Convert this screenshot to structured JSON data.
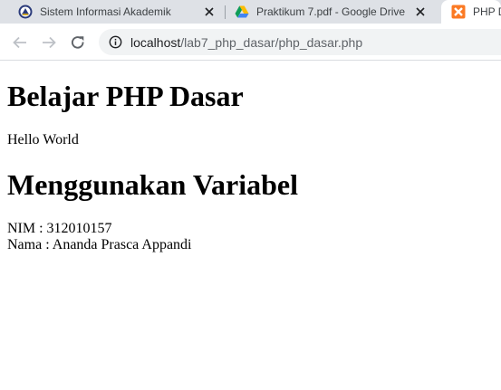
{
  "browser": {
    "tabs": [
      {
        "title": "Sistem Informasi Akademik",
        "icon": "university-logo-icon",
        "active": false
      },
      {
        "title": "Praktikum 7.pdf - Google Drive",
        "icon": "google-drive-icon",
        "active": false
      },
      {
        "title": "PHP D",
        "icon": "xampp-icon",
        "active": true
      }
    ],
    "url": {
      "host": "localhost",
      "path": "/lab7_php_dasar/php_dasar.php"
    }
  },
  "page": {
    "heading1": "Belajar PHP Dasar",
    "text1": "Hello World",
    "heading2": "Menggunakan Variabel",
    "nim": "NIM : 312010157",
    "nama": "Nama : Ananda Prasca Appandi"
  }
}
